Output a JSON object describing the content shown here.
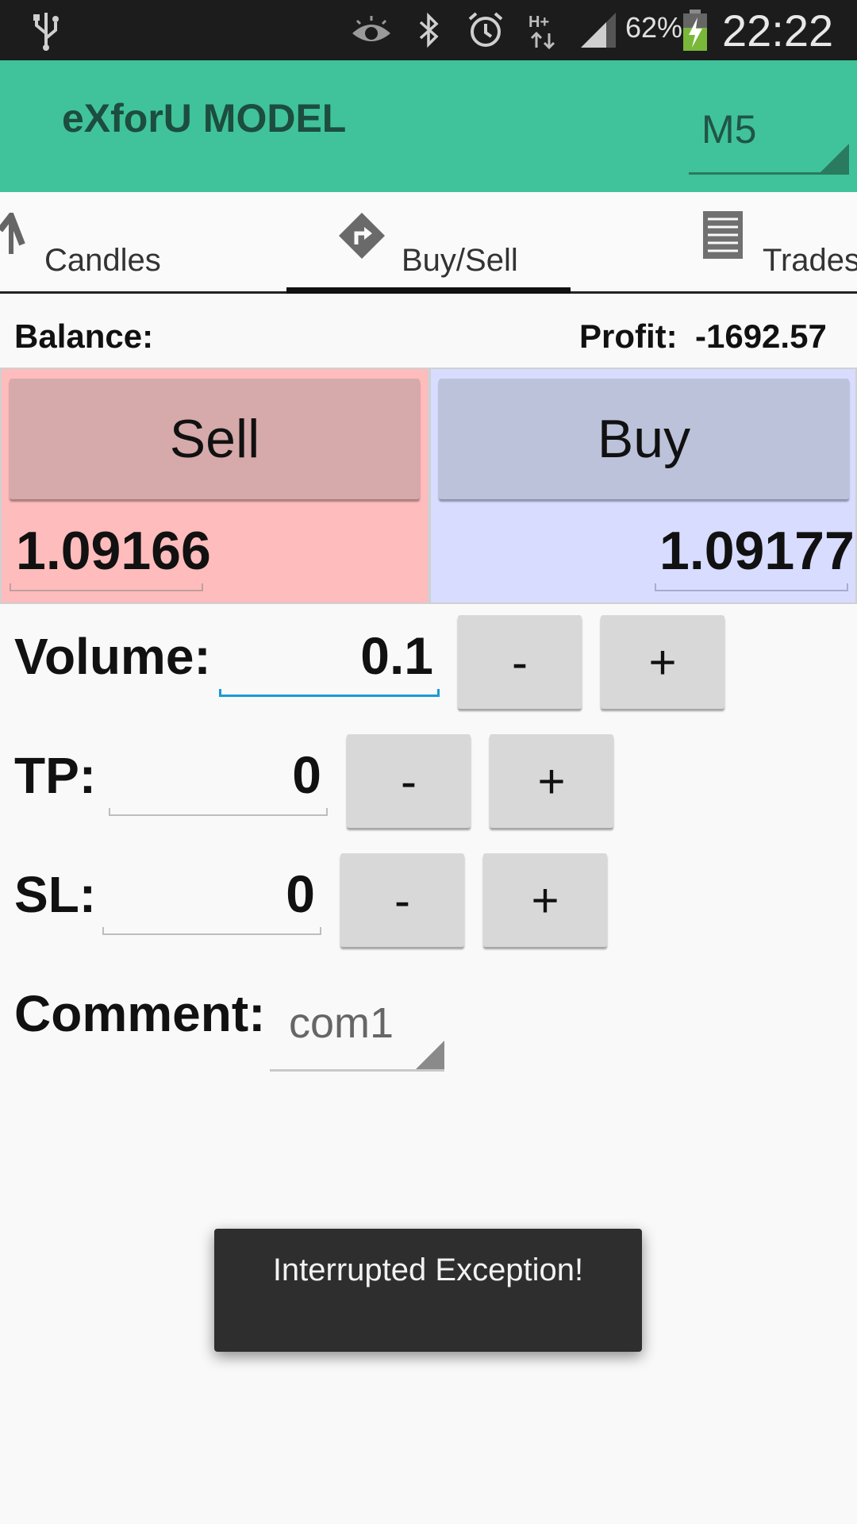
{
  "status_bar": {
    "battery_percent": "62%",
    "time": "22:22",
    "network": "H+",
    "icons": [
      "usb-icon",
      "eye-icon",
      "bluetooth-icon",
      "alarm-icon",
      "network-type-icon",
      "signal-icon",
      "battery-charging-icon"
    ]
  },
  "action_bar": {
    "title": "eXforU MODEL",
    "timeframe": "M5"
  },
  "tabs": [
    {
      "label": "Candles",
      "icon": "candles-icon"
    },
    {
      "label": "Buy/Sell",
      "icon": "direction-sign-icon",
      "selected": true
    },
    {
      "label": "Trades",
      "icon": "document-lines-icon"
    }
  ],
  "account": {
    "balance_label": "Balance:",
    "profit_label": "Profit:",
    "profit_value": "-1692.57"
  },
  "trade": {
    "sell_label": "Sell",
    "sell_price": "1.09166",
    "buy_label": "Buy",
    "buy_price": "1.09177"
  },
  "form": {
    "volume_label": "Volume:",
    "volume_value": "0.1",
    "tp_label": "TP:",
    "tp_value": "0",
    "sl_label": "SL:",
    "sl_value": "0",
    "minus_label": "-",
    "plus_label": "+",
    "comment_label": "Comment:",
    "comment_value": "com1"
  },
  "toast": {
    "message": "Interrupted Exception!"
  },
  "colors": {
    "action_bar": "#40c39a",
    "sell_panel": "#ffbcbc",
    "buy_panel": "#d8dcff",
    "active_underline": "#1a9ad6"
  }
}
